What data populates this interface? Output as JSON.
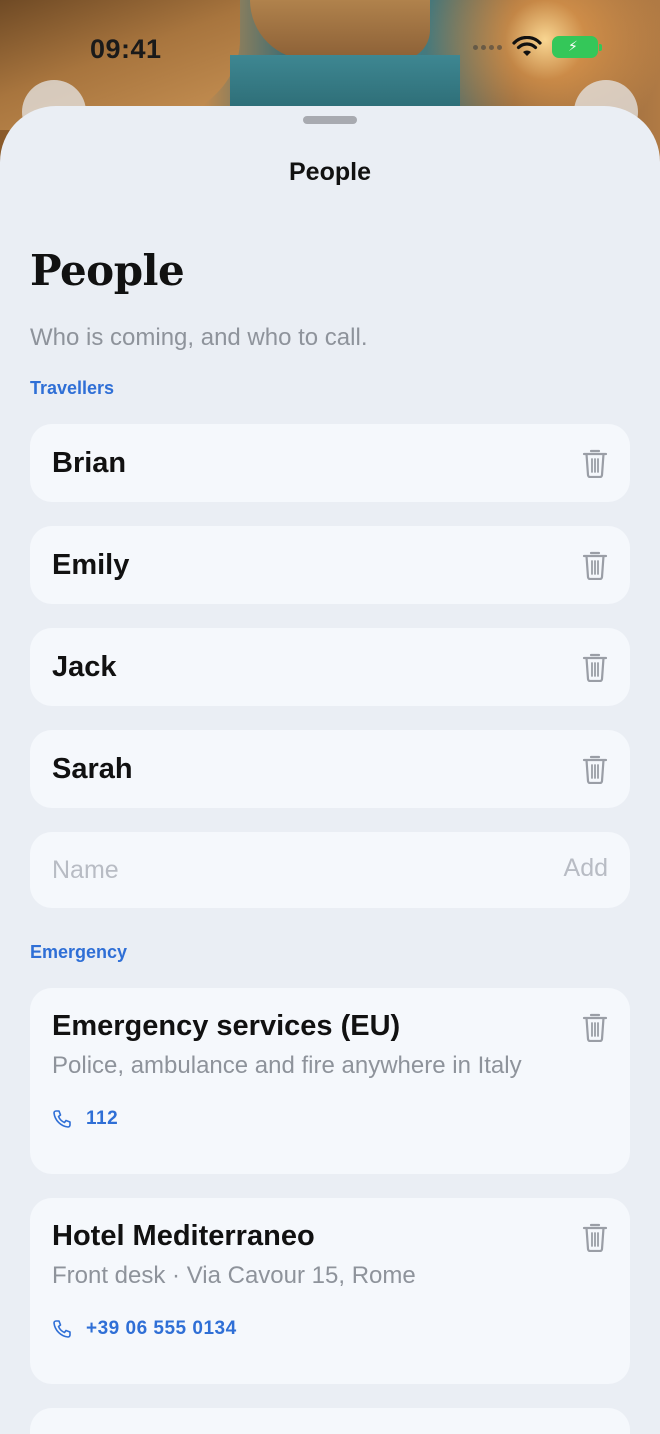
{
  "status_bar": {
    "time": "09:41"
  },
  "nav": {
    "title": "People"
  },
  "header": {
    "title": "People",
    "subtitle": "Who is coming, and who to call."
  },
  "travellers": {
    "label": "Travellers",
    "people": [
      {
        "name": "Brian"
      },
      {
        "name": "Emily"
      },
      {
        "name": "Jack"
      },
      {
        "name": "Sarah"
      }
    ],
    "add_form": {
      "placeholder": "Name",
      "add_label": "Add"
    }
  },
  "emergency": {
    "label": "Emergency",
    "contacts": [
      {
        "name": "Emergency services (EU)",
        "detail": "Police, ambulance and fire anywhere in Italy",
        "phone": "112"
      },
      {
        "name": "Hotel Mediterraneo",
        "detail": "Front desk · Via Cavour 15, Rome",
        "phone": "+39 06 555 0134"
      }
    ]
  },
  "colors": {
    "accent": "#2f6fd6",
    "sheet_background": "#eaeef4",
    "card_background": "#f5f8fc",
    "secondary_text": "#8e939b",
    "battery": "#34c759"
  }
}
